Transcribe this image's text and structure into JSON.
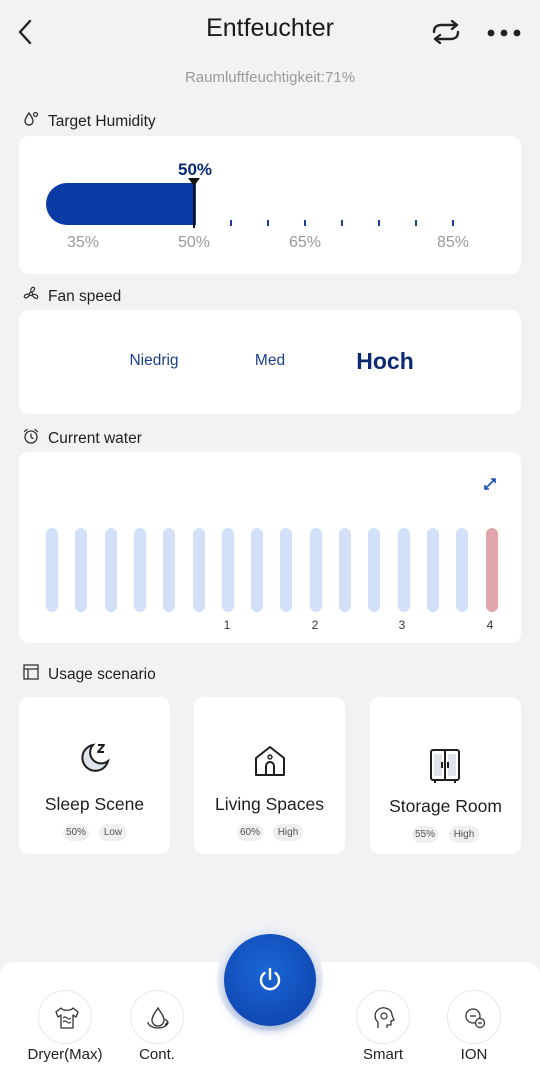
{
  "header": {
    "title": "Entfeuchter",
    "subtitle": "Raumluftfeuchtigkeit:71%"
  },
  "humidity": {
    "label": "Target Humidity",
    "value_label": "50%",
    "value": 50,
    "range": [
      35,
      85
    ],
    "scale": [
      "35%",
      "50%",
      "65%",
      "85%"
    ],
    "accent": "#0a3aa6"
  },
  "fan": {
    "label": "Fan speed",
    "options": [
      "Niedrig",
      "Med",
      "Hoch"
    ],
    "selected": "Hoch"
  },
  "water": {
    "label": "Current water",
    "bar_count": 16,
    "active_index": 15,
    "labels": [
      "1",
      "2",
      "3",
      "4"
    ],
    "colors": {
      "idle": "#d2e0fa",
      "active": "#dfa7ad"
    }
  },
  "scenario": {
    "label": "Usage scenario",
    "items": [
      {
        "name": "Sleep Scene",
        "icon": "moon-sleep-icon",
        "humidity": "50%",
        "fan": "Low"
      },
      {
        "name": "Living Spaces",
        "icon": "house-icon",
        "humidity": "60%",
        "fan": "High"
      },
      {
        "name": "Storage Room",
        "icon": "wardrobe-icon",
        "humidity": "55%",
        "fan": "High"
      }
    ]
  },
  "modes": [
    {
      "label": "Dryer(Max)",
      "icon": "shirt-dry-icon"
    },
    {
      "label": "Cont.",
      "icon": "drop-cycle-icon"
    },
    {
      "label": "Smart",
      "icon": "head-gear-icon"
    },
    {
      "label": "ION",
      "icon": "ion-icon"
    }
  ],
  "power": {
    "icon": "power-icon"
  }
}
